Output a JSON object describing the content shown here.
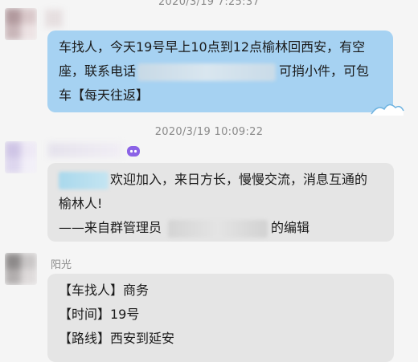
{
  "chat": {
    "timestamp_top": "2020/3/19 7:25:37",
    "message1": {
      "line1": "车找人，今天19号早上10点到12点榆林回西安，有空",
      "line2_start": "座，联系电话",
      "line2_end": "可捎小件，可包",
      "line3": "车【每天往返】"
    },
    "timestamp_mid": "2020/3/19 10:09:22",
    "message2": {
      "line1_end": "欢迎加入，来日方长，慢慢交流，消息互通的",
      "line2": "榆林人!",
      "line3_start": "——来自群管理员",
      "line3_end": "的编辑"
    },
    "message3": {
      "sender": "阳光",
      "line1": "【车找人】商务",
      "line2": "【时间】19号",
      "line3": "【路线】西安到延安"
    }
  },
  "colors": {
    "background": "#f5f5f5",
    "outgoing_bubble": "#a6d2f2",
    "incoming_bubble": "#e5e5e5",
    "timestamp_text": "#8a8a8a"
  }
}
